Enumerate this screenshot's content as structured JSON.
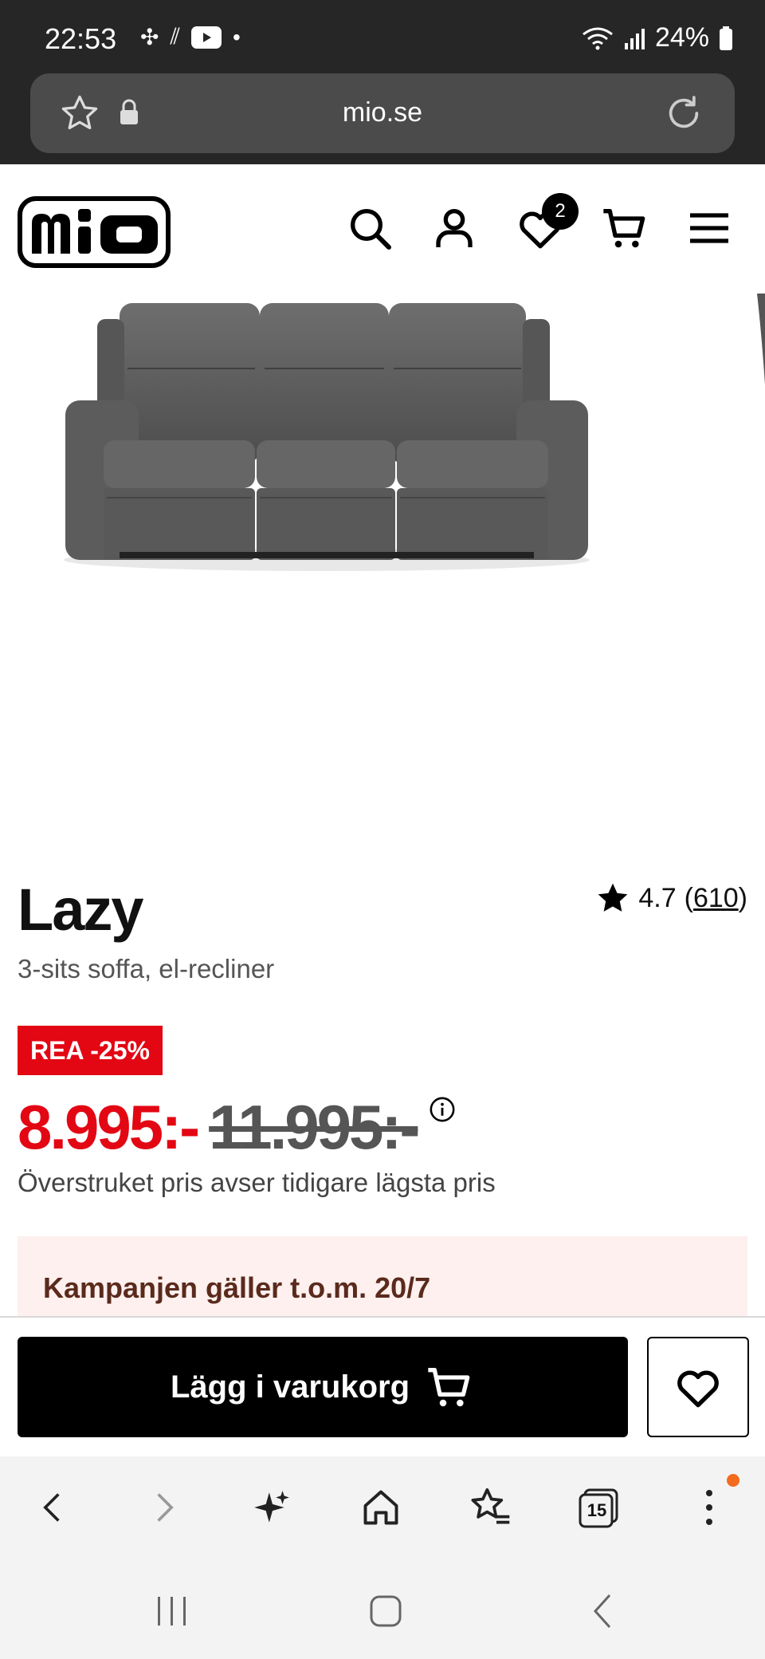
{
  "status_bar": {
    "time": "22:53",
    "battery": "24%"
  },
  "browser": {
    "url": "mio.se",
    "tab_count": "15"
  },
  "header": {
    "brand": "mio",
    "wishlist_count": "2"
  },
  "product": {
    "name": "Lazy",
    "subtitle": "3-sits soffa, el-recliner",
    "rating": "4.7",
    "review_count": "610",
    "sale_badge": "REA -25%",
    "price_now": "8.995:-",
    "price_old": "11.995:-",
    "price_note": "Överstruket pris avser tidigare lägsta pris",
    "campaign": "Kampanjen gäller t.o.m. 20/7"
  },
  "actions": {
    "add_to_cart": "Lägg i varukorg"
  },
  "colors": {
    "sale_red": "#e30613",
    "primary_black": "#000000",
    "campaign_bg": "#fdf0ee"
  }
}
